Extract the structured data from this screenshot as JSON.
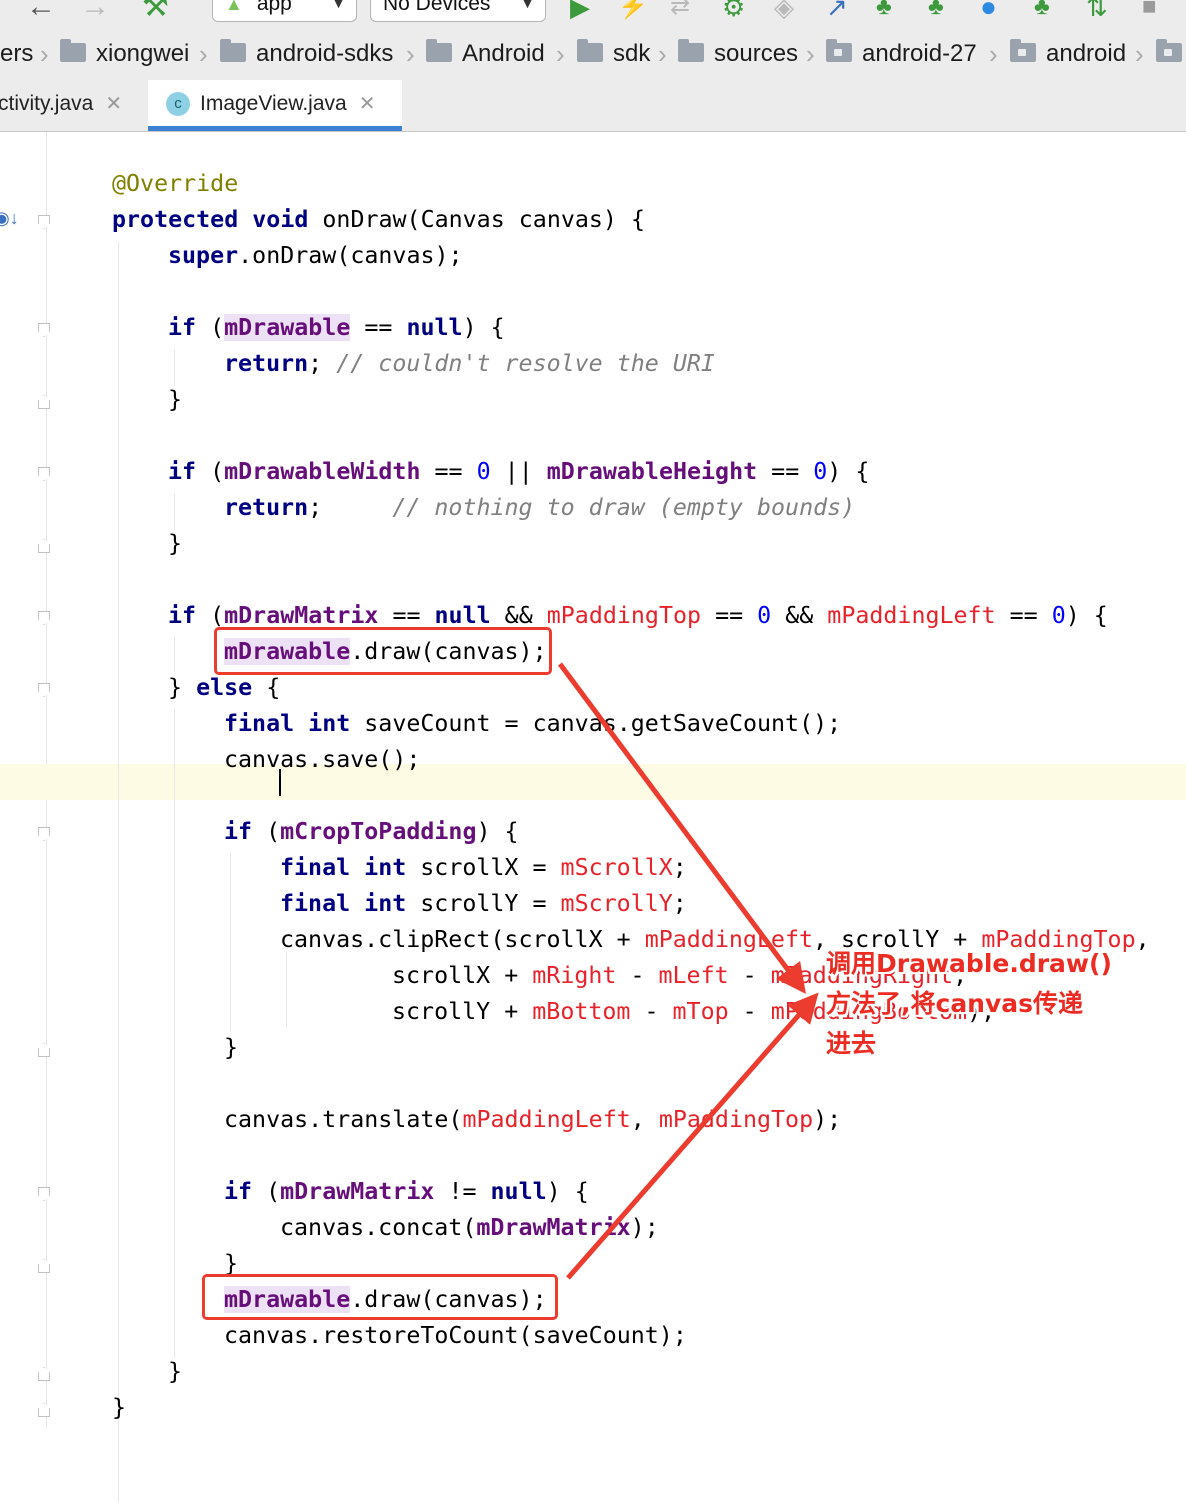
{
  "toolbar": {
    "run_config": "app",
    "device": "No Devices",
    "icons": [
      "back-arrow-icon",
      "forward-arrow-icon",
      "build-hammer-icon",
      "android-icon",
      "run-icon",
      "apply-changes-icon",
      "bug-icon",
      "profile-icon",
      "jira-icon",
      "info-icon",
      "sync-icon"
    ]
  },
  "breadcrumb": [
    "ers",
    "xiongwei",
    "android-sdks",
    "Android",
    "sdk",
    "sources",
    "android-27",
    "android"
  ],
  "tabs": [
    {
      "label": "ctivity.java",
      "active": false
    },
    {
      "label": "ImageView.java",
      "active": true
    }
  ],
  "editor": {
    "lines": [
      "@Override",
      "protected void onDraw(Canvas canvas) {",
      "super.onDraw(canvas);",
      "if (mDrawable == null) {",
      "return; // couldn't resolve the URI",
      "}",
      "if (mDrawableWidth == 0 || mDrawableHeight == 0) {",
      "return;     // nothing to draw (empty bounds)",
      "}",
      "if (mDrawMatrix == null && mPaddingTop == 0 && mPaddingLeft == 0) {",
      "mDrawable.draw(canvas);",
      "} else {",
      "final int saveCount = canvas.getSaveCount();",
      "canvas.save();",
      "if (mCropToPadding) {",
      "final int scrollX = mScrollX;",
      "final int scrollY = mScrollY;",
      "canvas.clipRect(scrollX + mPaddingLeft, scrollY + mPaddingTop,",
      "scrollX + mRight - mLeft - mPaddingRight,",
      "scrollY + mBottom - mTop - mPaddingBottom);",
      "}",
      "canvas.translate(mPaddingLeft, mPaddingTop);",
      "if (mDrawMatrix != null) {",
      "canvas.concat(mDrawMatrix);",
      "}",
      "mDrawable.draw(canvas);",
      "canvas.restoreToCount(saveCount);",
      "}",
      "}"
    ]
  },
  "annotation": {
    "text": "调用Drawable.draw()\n方法了,将canvas传递\n进去",
    "color": "#ec3b2f"
  }
}
